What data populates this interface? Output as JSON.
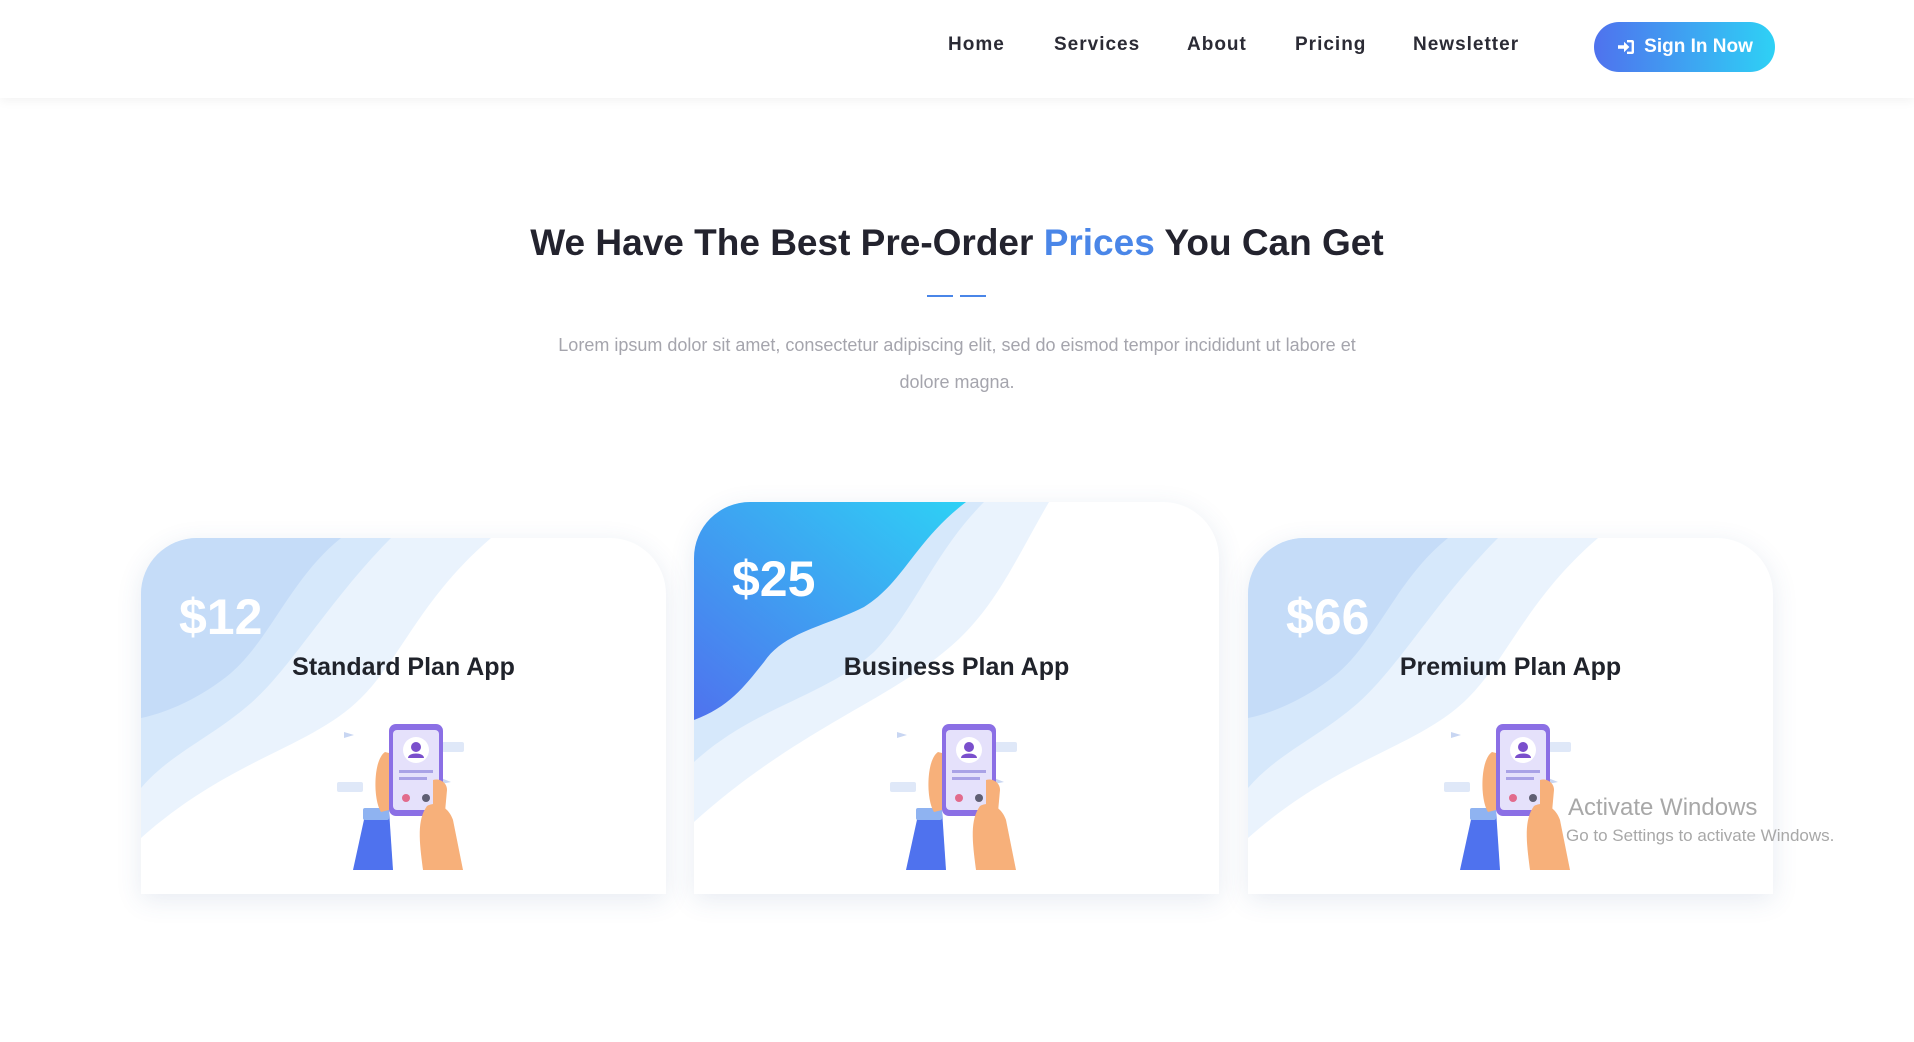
{
  "nav": {
    "items": [
      "Home",
      "Services",
      "About",
      "Pricing",
      "Newsletter"
    ],
    "signin_label": "Sign In Now",
    "signin_icon": "sign-in-icon"
  },
  "section": {
    "title_part1": "We Have The Best Pre-Order ",
    "title_accent": "Prices",
    "title_part2": " You Can Get",
    "subtitle": "Lorem ipsum dolor sit amet, consectetur adipiscing elit, sed do eismod tempor incididunt ut labore et dolore magna."
  },
  "plans": [
    {
      "price": "$12",
      "name": "Standard Plan App"
    },
    {
      "price": "$25",
      "name": "Business Plan App"
    },
    {
      "price": "$66",
      "name": "Premium Plan App"
    }
  ],
  "watermark": {
    "line1": "Activate Windows",
    "line2": "Go to Settings to activate Windows."
  },
  "colors": {
    "accent": "#4a86e8",
    "gradient_start": "#4f72ee",
    "gradient_end": "#2ed1f5"
  }
}
